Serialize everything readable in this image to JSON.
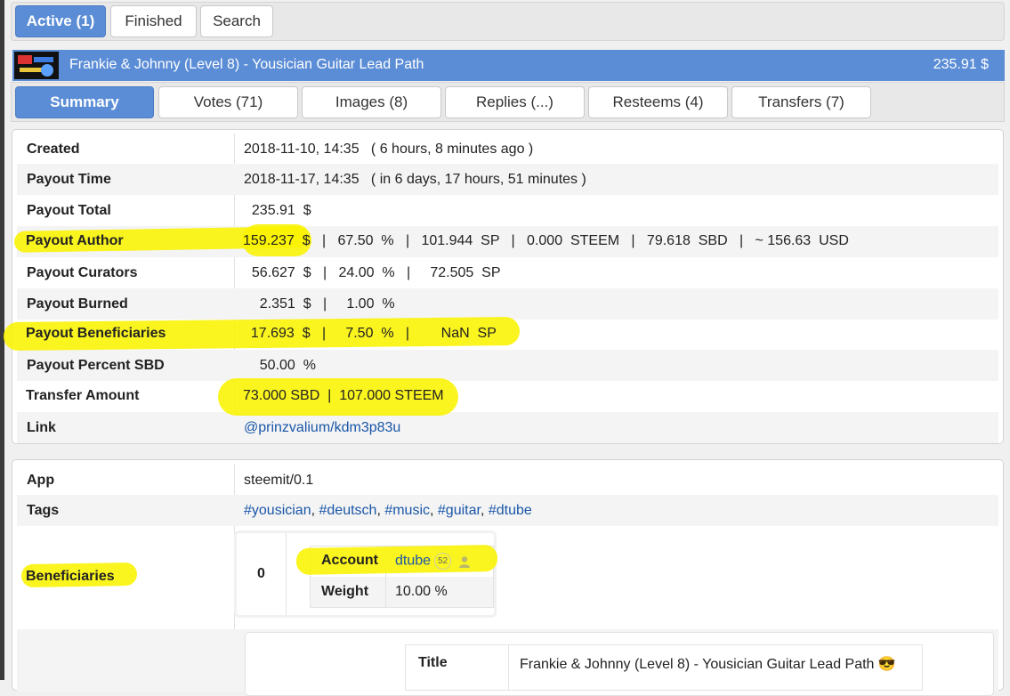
{
  "tabs": [
    {
      "label": "Active (1)",
      "active": true
    },
    {
      "label": "Finished",
      "active": false
    },
    {
      "label": "Search",
      "active": false
    }
  ],
  "post": {
    "title": "Frankie & Johnny (Level 8) - Yousician Guitar Lead Path",
    "amount": "235.91 $",
    "thumbnail_icon": "post-thumbnail-image"
  },
  "subtabs": [
    {
      "label": "Summary",
      "active": true
    },
    {
      "label": "Votes (71)",
      "active": false
    },
    {
      "label": "Images (8)",
      "active": false
    },
    {
      "label": "Replies (...)",
      "active": false
    },
    {
      "label": "Resteems (4)",
      "active": false
    },
    {
      "label": "Transfers (7)",
      "active": false
    }
  ],
  "summary": {
    "created": {
      "label": "Created",
      "value": "2018-11-10, 14:35   ( 6 hours, 8 minutes ago )"
    },
    "payout_time": {
      "label": "Payout Time",
      "value": "2018-11-17, 14:35   ( in 6 days, 17 hours, 51 minutes )"
    },
    "payout_total": {
      "label": "Payout Total",
      "value": "  235.91  $"
    },
    "payout_author": {
      "label": "Payout Author",
      "value": "159.237  $   |   67.50  %   |   101.944  SP   |   0.000  STEEM   |   79.618  SBD   |   ~ 156.63  USD"
    },
    "payout_curators": {
      "label": "Payout Curators",
      "value": "  56.627  $   |   24.00  %   |     72.505  SP"
    },
    "payout_burned": {
      "label": "Payout Burned",
      "value": "    2.351  $   |     1.00  %"
    },
    "payout_beneficiaries": {
      "label": "Payout Beneficiaries",
      "value": "  17.693  $   |     7.50  %   |        NaN  SP"
    },
    "payout_percent_sbd": {
      "label": "Payout Percent SBD",
      "value": "    50.00  %"
    },
    "transfer_amount": {
      "label": "Transfer Amount",
      "value": "73.000 SBD  |  107.000 STEEM"
    },
    "link": {
      "label": "Link",
      "value": "@prinzvalium/kdm3p83u"
    }
  },
  "details": {
    "app": {
      "label": "App",
      "value": "steemit/0.1"
    },
    "tags": {
      "label": "Tags",
      "values": [
        "#yousician",
        "#deutsch",
        "#music",
        "#guitar",
        "#dtube"
      ]
    },
    "beneficiaries": {
      "label": "Beneficiaries",
      "index": "0",
      "account_label": "Account",
      "account": "dtube",
      "account_rep": "52",
      "weight_label": "Weight",
      "weight": "10.00 %"
    },
    "metadata": {
      "title_label": "Title",
      "title": "Frankie & Johnny (Level 8) - Yousician Guitar Lead Path 😎"
    }
  },
  "colors": {
    "accent": "#5b8dd6",
    "highlight": "#f9f200",
    "link": "#1a56a8"
  }
}
